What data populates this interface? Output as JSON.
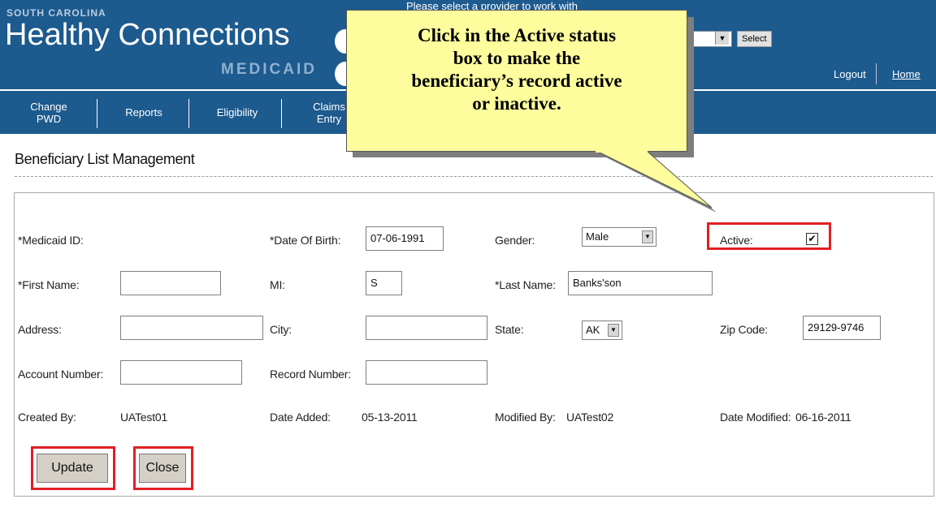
{
  "header": {
    "brand_top": "SOUTH CAROLINA",
    "brand_main": "Healthy Connections",
    "brand_sub": "MEDICAID",
    "top_message": "Please select a provider to work with",
    "select_button": "Select",
    "logout": "Logout",
    "home": "Home"
  },
  "nav": {
    "items": [
      {
        "label": "Change PWD"
      },
      {
        "label": "Reports"
      },
      {
        "label": "Eligibility"
      },
      {
        "label": "Claims Entry"
      }
    ]
  },
  "page": {
    "title": "Beneficiary List Management"
  },
  "form": {
    "medicaid_id_label": "*Medicaid ID:",
    "dob_label": "*Date Of Birth:",
    "dob_value": "07-06-1991",
    "gender_label": "Gender:",
    "gender_value": "Male",
    "active_label": "Active:",
    "active_mark": "✔",
    "first_name_label": "*First Name:",
    "first_name_value": "",
    "mi_label": "MI:",
    "mi_value": "S",
    "last_name_label": "*Last Name:",
    "last_name_value": "Banks'son",
    "address_label": "Address:",
    "address_value": "",
    "city_label": "City:",
    "city_value": "",
    "state_label": "State:",
    "state_value": "AK",
    "zip_label": "Zip Code:",
    "zip_value": "29129-9746",
    "account_label": "Account Number:",
    "account_value": "",
    "record_label": "Record Number:",
    "record_value": "",
    "created_by_label": "Created By:",
    "created_by_value": "UATest01",
    "date_added_label": "Date Added:",
    "date_added_value": "05-13-2011",
    "modified_by_label": "Modified By:",
    "modified_by_value": "UATest02",
    "date_modified_label": "Date Modified:",
    "date_modified_value": "06-16-2011",
    "update_button": "Update",
    "close_button": "Close"
  },
  "callout": {
    "lines": [
      "Click in the Active status",
      "box to make the",
      "beneficiary’s record active",
      "or inactive."
    ]
  },
  "colors": {
    "header_blue": "#1d5a8e",
    "callout_yellow": "#fdfd9d",
    "highlight_red": "#e21f26"
  }
}
